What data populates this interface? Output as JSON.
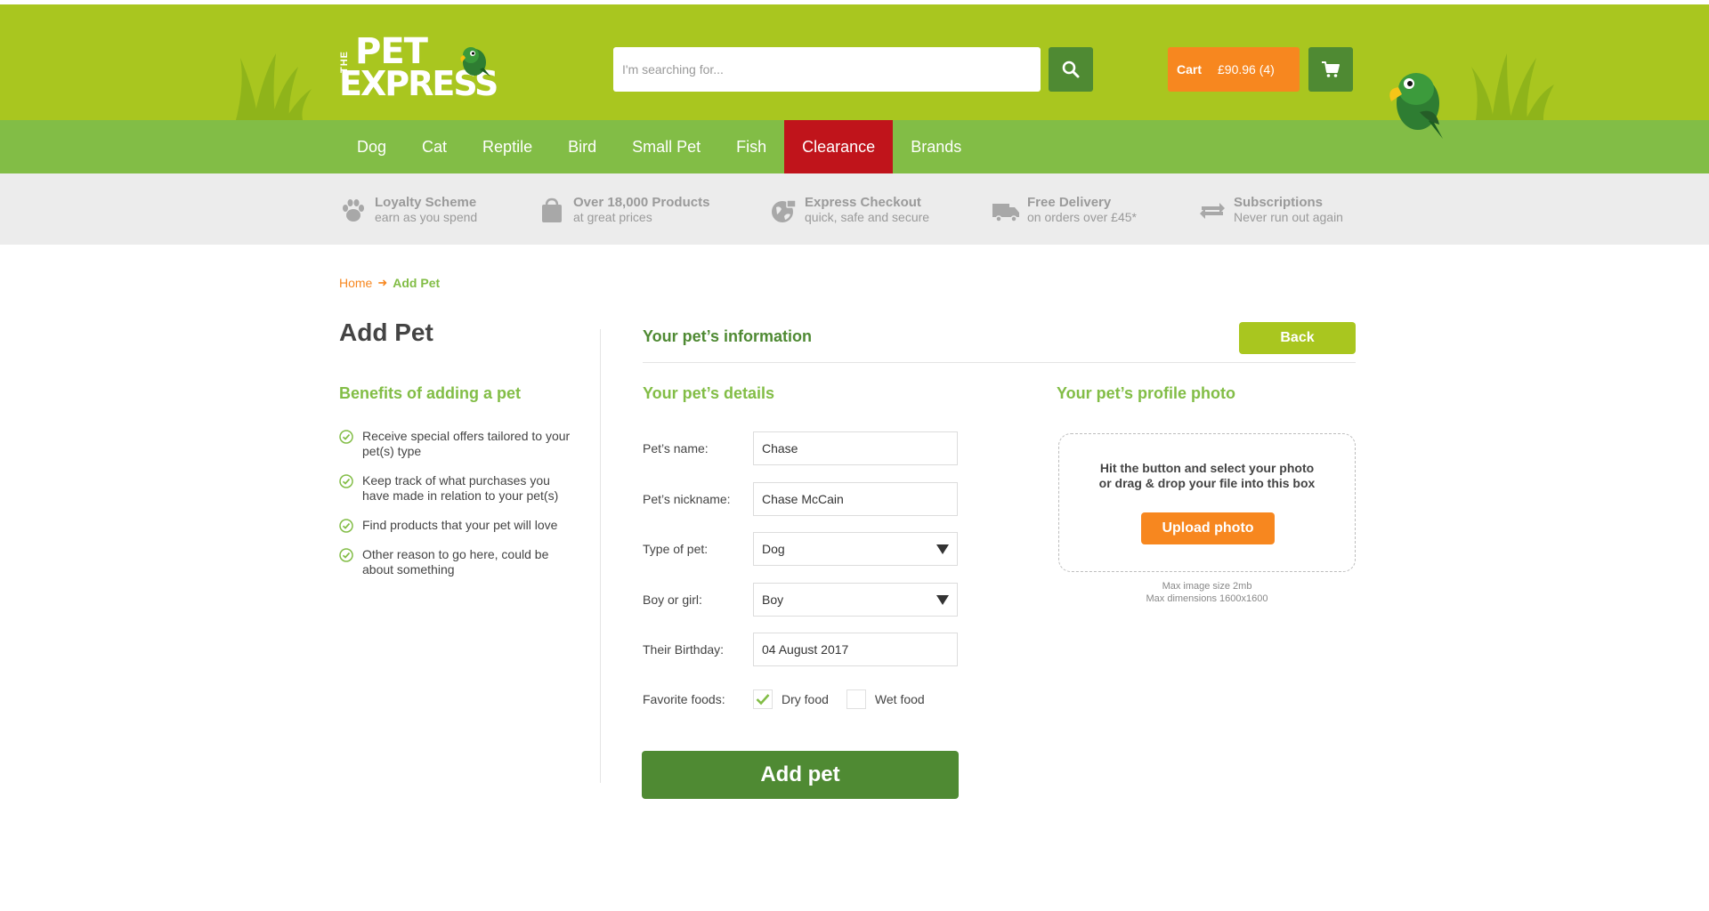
{
  "header": {
    "logo_the": "THE",
    "logo_pet": "PET",
    "logo_express": "EXPRESS",
    "search_placeholder": "I'm searching for...",
    "cart_label": "Cart",
    "cart_value": "£90.96 (4)"
  },
  "nav": {
    "items": [
      "Dog",
      "Cat",
      "Reptile",
      "Bird",
      "Small Pet",
      "Fish",
      "Clearance",
      "Brands"
    ],
    "active": "Clearance"
  },
  "usps": [
    {
      "title": "Loyalty Scheme",
      "subtitle": "earn as you spend",
      "icon": "paw-icon"
    },
    {
      "title": "Over 18,000 Products",
      "subtitle": "at great prices",
      "icon": "shopping-bag-icon"
    },
    {
      "title": "Express Checkout",
      "subtitle": "quick, safe and secure",
      "icon": "secure-globe-icon"
    },
    {
      "title": "Free Delivery",
      "subtitle": "on orders over £45*",
      "icon": "delivery-truck-icon"
    },
    {
      "title": "Subscriptions",
      "subtitle": "Never run out again",
      "icon": "repeat-icon"
    }
  ],
  "breadcrumb": {
    "home": "Home",
    "current": "Add Pet"
  },
  "sidebar": {
    "title": "Add Pet",
    "benefits_title": "Benefits of adding a pet",
    "benefits": [
      "Receive special offers tailored to your pet(s) type",
      "Keep track of what purchases you have made in relation to your pet(s)",
      "Find products that your pet will love",
      "Other reason to go here, could be about something"
    ]
  },
  "main": {
    "section_title": "Your pet’s information",
    "back_label": "Back",
    "details_title": "Your pet’s details",
    "photo_title": "Your pet’s profile photo",
    "form": {
      "name_label": "Pet’s name:",
      "name_value": "Chase",
      "nickname_label": "Pet’s nickname:",
      "nickname_value": "Chase McCain",
      "type_label": "Type of pet:",
      "type_value": "Dog",
      "gender_label": "Boy or girl:",
      "gender_value": "Boy",
      "birthday_label": "Their Birthday:",
      "birthday_value": "04 August 2017",
      "foods_label": "Favorite foods:",
      "foods": [
        {
          "label": "Dry food",
          "checked": true
        },
        {
          "label": "Wet food",
          "checked": false
        }
      ]
    },
    "submit_label": "Add pet",
    "upload": {
      "instructions_line1": "Hit the button and select your photo",
      "instructions_line2": "or drag & drop your file into this box",
      "button_label": "Upload photo",
      "note_line1": "Max image size 2mb",
      "note_line2": "Max dimensions 1600x1600"
    }
  },
  "colors": {
    "header_green": "#a9c61f",
    "nav_green": "#82bd46",
    "dark_green": "#4f8a33",
    "orange": "#f7871f",
    "clearance_red": "#c0141b"
  }
}
